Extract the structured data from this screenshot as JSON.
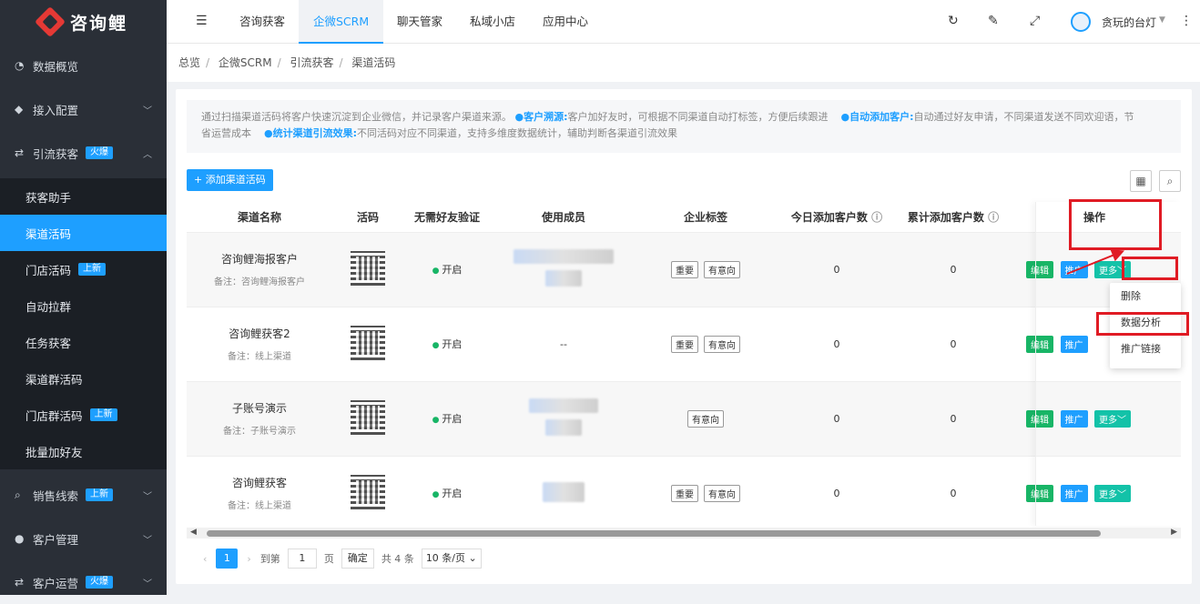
{
  "brand": {
    "name": "咨询鲤"
  },
  "sidebar": {
    "items": [
      {
        "label": "数据概览",
        "icon": "pie-chart-icon"
      },
      {
        "label": "接入配置",
        "icon": "cube-icon"
      },
      {
        "label": "引流获客",
        "icon": "swap-icon",
        "badge": "火爆"
      },
      {
        "label": "销售线索",
        "icon": "search-icon",
        "badge": "上新"
      },
      {
        "label": "客户管理",
        "icon": "user-icon"
      },
      {
        "label": "客户运营",
        "icon": "swap-icon",
        "badge": "火爆"
      }
    ],
    "subitems": [
      {
        "label": "获客助手"
      },
      {
        "label": "渠道活码",
        "active": true
      },
      {
        "label": "门店活码",
        "badge": "上新"
      },
      {
        "label": "自动拉群"
      },
      {
        "label": "任务获客"
      },
      {
        "label": "渠道群活码"
      },
      {
        "label": "门店群活码",
        "badge": "上新"
      },
      {
        "label": "批量加好友"
      }
    ]
  },
  "topbar": {
    "tabs": [
      "咨询获客",
      "企微SCRM",
      "聊天管家",
      "私域小店",
      "应用中心"
    ],
    "active_tab": "企微SCRM",
    "user": "贪玩的台灯"
  },
  "breadcrumb": [
    "总览",
    "企微SCRM",
    "引流获客",
    "渠道活码"
  ],
  "notice": {
    "intro": "通过扫描渠道活码将客户快速沉淀到企业微信，并记录客户渠道来源。",
    "p1_title": "客户溯源:",
    "p1_text": "客户加好友时，可根据不同渠道自动打标签，方便后续跟进",
    "p2_title": "自动添加客户:",
    "p2_text": "自动通过好友申请，不同渠道发送不同欢迎语，节",
    "p2_text2": "省运营成本",
    "p3_title": "统计渠道引流效果:",
    "p3_text": "不同活码对应不同渠道，支持多维度数据统计，辅助判断各渠道引流效果"
  },
  "toolbar": {
    "add_label": "+ 添加渠道活码"
  },
  "table": {
    "headers": [
      "渠道名称",
      "活码",
      "无需好友验证",
      "使用成员",
      "企业标签",
      "今日添加客户数",
      "累计添加客户数",
      "操作"
    ],
    "rows": [
      {
        "name": "咨询鲤海报客户",
        "note": "备注：咨询鲤海报客户",
        "verify": "开启",
        "members": "",
        "tags": [
          "重要",
          "有意向"
        ],
        "today": "0",
        "total": "0"
      },
      {
        "name": "咨询鲤获客2",
        "note": "备注：线上渠道",
        "verify": "开启",
        "members": "--",
        "tags": [
          "重要",
          "有意向"
        ],
        "today": "0",
        "total": "0"
      },
      {
        "name": "子账号演示",
        "note": "备注：子账号演示",
        "verify": "开启",
        "members": "",
        "tags": [
          "有意向"
        ],
        "today": "0",
        "total": "0"
      },
      {
        "name": "咨询鲤获客",
        "note": "备注：线上渠道",
        "verify": "开启",
        "members": "",
        "tags": [
          "重要",
          "有意向"
        ],
        "today": "0",
        "total": "0"
      }
    ],
    "actions": {
      "edit": "编辑",
      "promote": "推广",
      "more": "更多"
    }
  },
  "dropdown": {
    "items": [
      "删除",
      "数据分析",
      "推广链接"
    ]
  },
  "pager": {
    "current": "1",
    "goto_label": "到第",
    "goto_value": "1",
    "page_unit": "页",
    "confirm": "确定",
    "total": "共 4 条",
    "page_size": "10 条/页"
  }
}
